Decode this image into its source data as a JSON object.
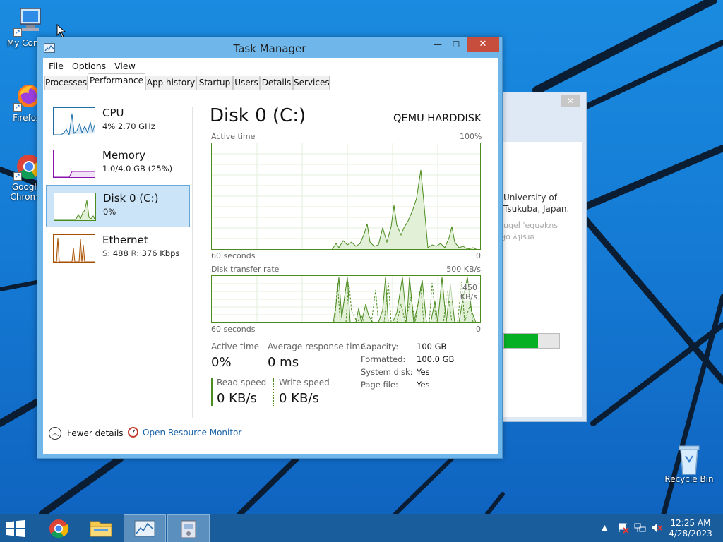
{
  "desktop": {
    "icons": [
      {
        "label": "My Comp",
        "icon": "computer-icon"
      },
      {
        "label": "Firefox",
        "icon": "firefox-icon"
      },
      {
        "label": "Google Chrome",
        "icon": "chrome-icon"
      },
      {
        "label": "Recycle Bin",
        "icon": "recycle-bin-icon"
      }
    ]
  },
  "background_window": {
    "text_line1": "University of",
    "text_line2": "Tsukuba, Japan.",
    "faded_line1": "uqeÍ 'equəkns",
    "faded_line2": "ɟo ʎʇisɹə",
    "progress": 0.62,
    "close_label": "✕"
  },
  "window": {
    "title": "Task Manager",
    "minimize": "—",
    "maximize": "☐",
    "close": "✕",
    "menu": [
      "File",
      "Options",
      "View"
    ],
    "tabs": [
      "Processes",
      "Performance",
      "App history",
      "Startup",
      "Users",
      "Details",
      "Services"
    ],
    "active_tab": "Performance"
  },
  "sidebar": {
    "items": [
      {
        "name": "CPU",
        "sub": "4%  2.70 GHz",
        "color": "#1e6fa8"
      },
      {
        "name": "Memory",
        "sub": "1.0/4.0 GB (25%)",
        "color": "#8b12ae"
      },
      {
        "name": "Disk 0 (C:)",
        "sub": "0%",
        "color": "#4b8b1f"
      },
      {
        "name": "Ethernet",
        "sub_s_label": "S:",
        "sub_s": "488",
        "sub_r_label": "R:",
        "sub_r": "376 Kbps",
        "color": "#a74f01"
      }
    ],
    "selected": 2
  },
  "detail": {
    "title": "Disk 0 (C:)",
    "model": "QEMU HARDDISK",
    "graph1": {
      "label": "Active time",
      "max": "100%",
      "time": "60 seconds",
      "min": "0"
    },
    "graph2": {
      "label": "Disk transfer rate",
      "max": "500 KB/s",
      "mid": "450 KB/s",
      "time": "60 seconds",
      "min": "0"
    },
    "stats": {
      "active_time_label": "Active time",
      "active_time": "0%",
      "avg_resp_label": "Average response time",
      "avg_resp": "0 ms",
      "read_label": "Read speed",
      "read": "0 KB/s",
      "write_label": "Write speed",
      "write": "0 KB/s"
    },
    "props": [
      {
        "k": "Capacity:",
        "v": "100 GB"
      },
      {
        "k": "Formatted:",
        "v": "100.0 GB"
      },
      {
        "k": "System disk:",
        "v": "Yes"
      },
      {
        "k": "Page file:",
        "v": "Yes"
      }
    ]
  },
  "footer": {
    "fewer_details": "Fewer details",
    "open_resource_monitor": "Open Resource Monitor"
  },
  "taskbar": {
    "clock_time": "12:25 AM",
    "clock_date": "4/28/2023"
  }
}
